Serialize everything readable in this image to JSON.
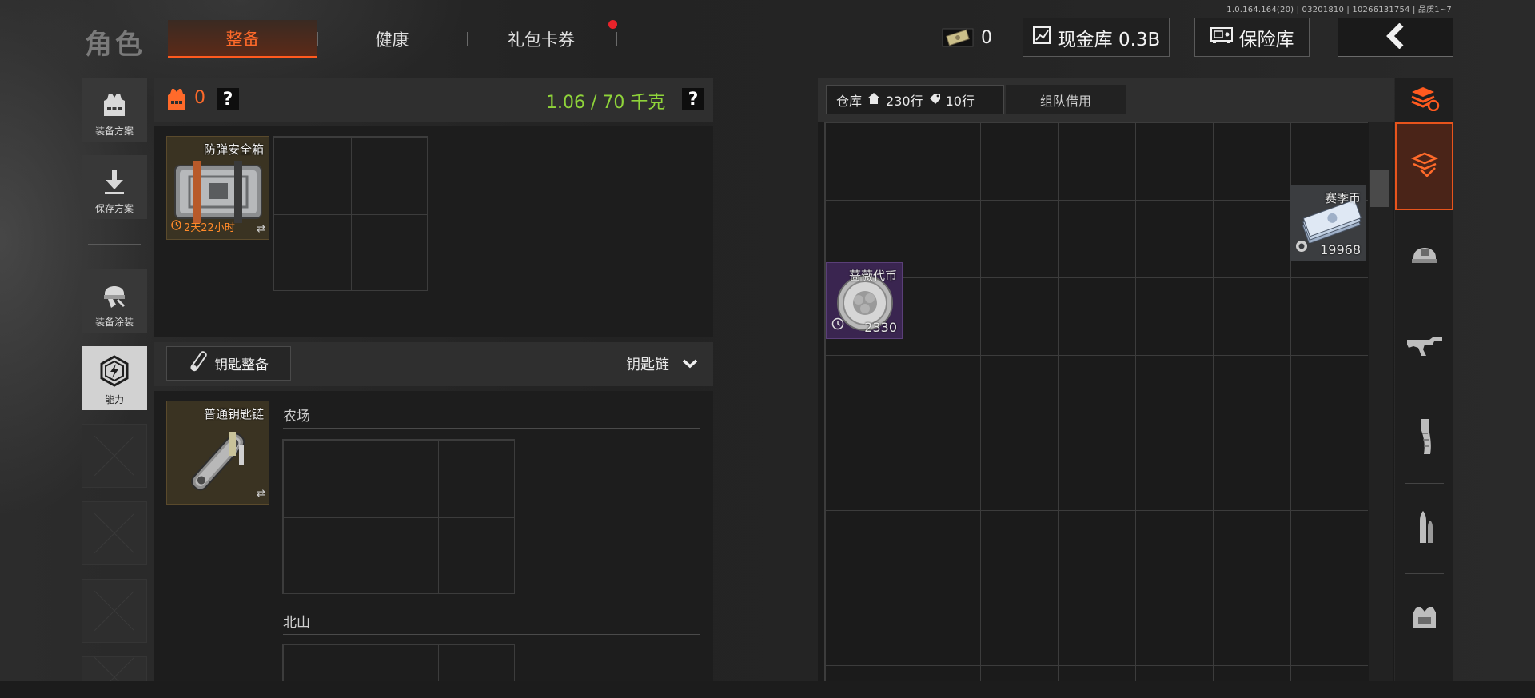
{
  "header": {
    "version": "1.0.164.164(20) | 03201810 | 10266131754 | 品质1~7",
    "title": "角色",
    "tabs": [
      {
        "label": "整备",
        "active": true
      },
      {
        "label": "健康",
        "active": false
      },
      {
        "label": "礼包卡券",
        "active": false,
        "badge": true
      }
    ],
    "money_amount": "0",
    "cash_vault_label": "现金库 0.3B",
    "safe_label": "保险库",
    "back_icon": "chevron-left-icon"
  },
  "sidebar": {
    "items": [
      {
        "label": "装备方案",
        "icon": "vest-icon"
      },
      {
        "label": "保存方案",
        "icon": "download-icon"
      },
      {
        "label": "装备涂装",
        "icon": "helmet-paint-icon"
      },
      {
        "label": "能力",
        "icon": "ability-bolt-icon"
      }
    ]
  },
  "gear": {
    "armor_value": "0",
    "weight": "1.06 / 70 千克",
    "help": "?",
    "secure_case": {
      "name": "防弹安全箱",
      "timer": "2天22小时"
    }
  },
  "keys": {
    "button_label": "钥匙整备",
    "dropdown_label": "钥匙链",
    "keychain_item": "普通钥匙链",
    "sections": [
      "农场",
      "北山"
    ]
  },
  "warehouse": {
    "tab_label": "仓库",
    "rows_total": "230行",
    "rows_extra": "10行",
    "team_borrow": "组队借用",
    "items": [
      {
        "name": "赛季币",
        "count": "19968"
      },
      {
        "name": "蔷薇代币",
        "count": "2330"
      }
    ],
    "filters": [
      "all-items-icon",
      "helmet-icon",
      "rifle-icon",
      "magazine-icon",
      "ammo-icon",
      "armor-vest-icon"
    ]
  },
  "colors": {
    "accent": "#ff5a1f",
    "weight_green": "#8fd43a",
    "purple_item": "#3a2550",
    "gold_item": "#3a3322"
  }
}
